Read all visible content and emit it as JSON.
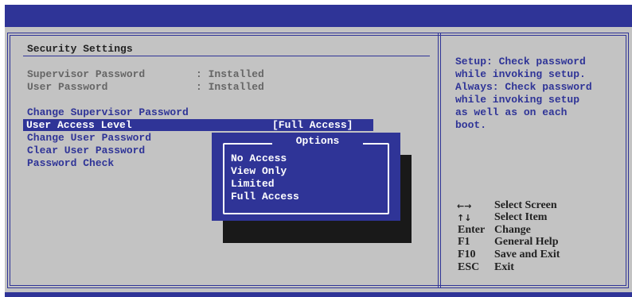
{
  "left_panel": {
    "title": "Security Settings",
    "status_rows": [
      {
        "label": "Supervisor Password",
        "value": ": Installed"
      },
      {
        "label": "User Password",
        "value": ": Installed"
      }
    ],
    "menu_items": [
      "Change Supervisor Password",
      "User Access Level",
      "Change User Password",
      "Clear User Password",
      "Password Check"
    ],
    "selected_value": "[Full Access]"
  },
  "popup": {
    "title": "Options",
    "options": [
      "No Access",
      "View Only",
      "Limited",
      "Full Access"
    ]
  },
  "help": {
    "lines": [
      "Setup: Check password",
      "while invoking setup.",
      "Always: Check password",
      "while invoking setup",
      "as well as on each",
      "boot."
    ]
  },
  "key_legend": [
    {
      "key_icon": "left-right-arrows-icon",
      "key": "",
      "action": "Select Screen"
    },
    {
      "key_icon": "up-down-arrows-icon",
      "key": "",
      "action": "Select Item"
    },
    {
      "key_icon": "",
      "key": "Enter",
      "action": "Change"
    },
    {
      "key_icon": "",
      "key": "F1",
      "action": "General Help"
    },
    {
      "key_icon": "",
      "key": "F10",
      "action": "Save and Exit"
    },
    {
      "key_icon": "",
      "key": "ESC",
      "action": "Exit"
    }
  ],
  "colors": {
    "bios_blue": "#2f3497",
    "panel_gray": "#c3c3c3",
    "text_white": "#ffffff",
    "shadow": "#191919"
  }
}
